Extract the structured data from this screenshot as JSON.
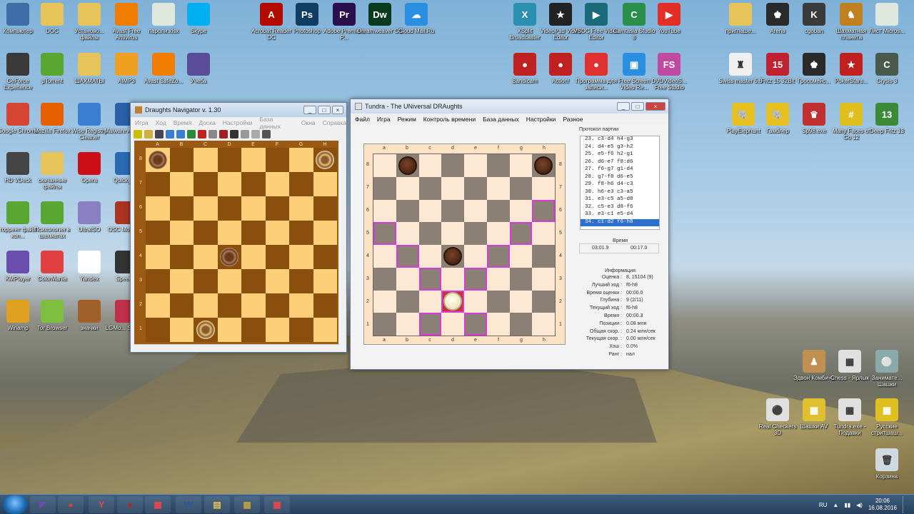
{
  "desktop": {
    "left_icons": [
      {
        "label": "Компьютер",
        "name": "computer-icon",
        "color": "#3d6ea8"
      },
      {
        "label": "DOC",
        "name": "folder-icon",
        "color": "#e6c45a"
      },
      {
        "label": "Установо... файлы",
        "name": "folder-icon",
        "color": "#e6c45a"
      },
      {
        "label": "Avast Free Antivirus",
        "name": "avast-icon",
        "color": "#f07d00"
      },
      {
        "label": "пароли.xlsx",
        "name": "excel-file-icon",
        "color": "#dfe8df"
      },
      {
        "label": "Skype",
        "name": "skype-icon",
        "color": "#00aff0"
      },
      {
        "label": "GeForce Experience",
        "name": "geforce-icon",
        "color": "#3a3a3a"
      },
      {
        "label": "µTorrent",
        "name": "utorrent-icon",
        "color": "#5aa632"
      },
      {
        "label": "ШАХМАТЫ",
        "name": "folder-icon",
        "color": "#e6c45a"
      },
      {
        "label": "AIMP3",
        "name": "aimp-icon",
        "color": "#f0a020"
      },
      {
        "label": "Avast SafeZo...",
        "name": "avast-safezone-icon",
        "color": "#f07d00"
      },
      {
        "label": "Учеба",
        "name": "folder-icon",
        "color": "#5b4c9a"
      },
      {
        "label": "Google Chrome",
        "name": "chrome-icon",
        "color": "#d64534"
      },
      {
        "label": "Mozilla Firefox",
        "name": "firefox-icon",
        "color": "#e66000"
      },
      {
        "label": "Wise Registry Cleaner",
        "name": "wise-icon",
        "color": "#3a7fcf"
      },
      {
        "label": "Malware Anti-M...",
        "name": "malware-icon",
        "color": "#2b5fa8"
      },
      {
        "label": "HD VDeck",
        "name": "hdvdeck-icon",
        "color": "#444"
      },
      {
        "label": "скачанные файлы",
        "name": "folder-icon",
        "color": "#e6c45a"
      },
      {
        "label": "Opera",
        "name": "opera-icon",
        "color": "#cc0f16"
      },
      {
        "label": "Quick_A...",
        "name": "quick-icon",
        "color": "#2a6ab0"
      },
      {
        "label": "торрент файл кол...",
        "name": "torrent-file-icon",
        "color": "#5aa632"
      },
      {
        "label": "Психология в шахматах",
        "name": "file-icon",
        "color": "#5aa632"
      },
      {
        "label": "UltraISO",
        "name": "ultraiso-icon",
        "color": "#8a7fc0"
      },
      {
        "label": "OSC Mouse ...",
        "name": "osc-icon",
        "color": "#aa3322"
      },
      {
        "label": "KMPlayer",
        "name": "kmplayer-icon",
        "color": "#6a4fb0"
      },
      {
        "label": "ColorMania",
        "name": "colormania-icon",
        "color": "#e04040"
      },
      {
        "label": "Yandex",
        "name": "yandex-icon",
        "color": "#ffffff"
      },
      {
        "label": "Speed...",
        "name": "speed-icon",
        "color": "#333"
      },
      {
        "label": "Winamp",
        "name": "winamp-icon",
        "color": "#e0a020"
      },
      {
        "label": "Tor Browser",
        "name": "tor-icon",
        "color": "#7fbf3f"
      },
      {
        "label": "значки",
        "name": "briefcase-icon",
        "color": "#a0602a"
      },
      {
        "label": "LGMo... Support",
        "name": "lg-icon",
        "color": "#c0304a"
      }
    ],
    "top_icons": [
      {
        "label": "Acrobat Reader DC",
        "name": "acrobat-icon",
        "color": "#b30b00",
        "glyph": "A"
      },
      {
        "label": "Photoshop",
        "name": "photoshop-icon",
        "color": "#0f3d63",
        "glyph": "Ps"
      },
      {
        "label": "Adobe Premiere P...",
        "name": "premiere-icon",
        "color": "#2a0f4f",
        "glyph": "Pr"
      },
      {
        "label": "Dreamweaver CC",
        "name": "dreamweaver-icon",
        "color": "#0a3a1e",
        "glyph": "Dw"
      },
      {
        "label": "Cloud Mail.Ru",
        "name": "cloud-icon",
        "color": "#2a8fe0",
        "glyph": "☁"
      },
      {
        "label": "XSplit Broadcaster",
        "name": "xsplit-icon",
        "color": "#2a8fb0",
        "glyph": "X"
      },
      {
        "label": "VideoPad Video Editor",
        "name": "videopad-icon",
        "color": "#222",
        "glyph": "★"
      },
      {
        "label": "VSDC Free Video Editor",
        "name": "vsdc-icon",
        "color": "#1a6a7a",
        "glyph": "▶"
      },
      {
        "label": "Camtasia Studio 8",
        "name": "camtasia-icon",
        "color": "#2a8f4a",
        "glyph": "C"
      },
      {
        "label": "YouTube",
        "name": "youtube-icon",
        "color": "#e52d27",
        "glyph": "▶"
      },
      {
        "label": "Bandicam",
        "name": "bandicam-icon",
        "color": "#c02020",
        "glyph": "●"
      },
      {
        "label": "Action!",
        "name": "action-icon",
        "color": "#c02020",
        "glyph": "●"
      },
      {
        "label": "Программа для записи...",
        "name": "recorder-icon",
        "color": "#e03030",
        "glyph": "●"
      },
      {
        "label": "Free Screen Video Re...",
        "name": "screen-recorder-icon",
        "color": "#2a8fe0",
        "glyph": "▣"
      },
      {
        "label": "DVDVideoS... Free Studio",
        "name": "freestudio-icon",
        "color": "#c04aa0",
        "glyph": "FS"
      }
    ],
    "right_icons": [
      {
        "label": "приглаше...",
        "name": "folder-icon",
        "color": "#e6c45a",
        "glyph": ""
      },
      {
        "label": "Arena",
        "name": "arena-icon",
        "color": "#2a2a2a",
        "glyph": "♚"
      },
      {
        "label": "cgoban",
        "name": "cgoban-icon",
        "color": "#3a3a3a",
        "glyph": "K"
      },
      {
        "label": "Шахматная планета",
        "name": "chess-planet-icon",
        "color": "#c08020",
        "glyph": "♞"
      },
      {
        "label": "Лист Micros...",
        "name": "excel-sheet-icon",
        "color": "#dfe8df",
        "glyph": ""
      },
      {
        "label": "Swiss master 5.5",
        "name": "swiss-master-icon",
        "color": "#f0f0f0",
        "glyph": "♜"
      },
      {
        "label": "Fritz 15 32Bit",
        "name": "fritz-icon",
        "color": "#c02030",
        "glyph": "15"
      },
      {
        "label": "Гроссмейс...",
        "name": "grossmeister-icon",
        "color": "#2a2a2a",
        "glyph": "♚"
      },
      {
        "label": "PokerStars...",
        "name": "pokerstars-icon",
        "color": "#c02020",
        "glyph": "★"
      },
      {
        "label": "Crysis 3",
        "name": "crysis-icon",
        "color": "#4a5a4a",
        "glyph": "C"
      },
      {
        "label": "PlayElephant",
        "name": "playelephant-icon",
        "color": "#e6c020",
        "glyph": "🐘"
      },
      {
        "label": "Гамблер",
        "name": "gambler-icon",
        "color": "#e6c020",
        "glyph": "🐘"
      },
      {
        "label": "Sp98.exe",
        "name": "sp98-icon",
        "color": "#c03030",
        "glyph": "♛"
      },
      {
        "label": "Many Faces of Go 12",
        "name": "manyfaces-icon",
        "color": "#e0c020",
        "glyph": "#"
      },
      {
        "label": "Deep Fritz 13",
        "name": "deepfritz-icon",
        "color": "#3a8a3a",
        "glyph": "13"
      },
      {
        "label": "Эдвон Комби+2",
        "name": "edvon-icon",
        "color": "#c09050",
        "glyph": "♟"
      },
      {
        "label": "Chess - Ярлык",
        "name": "chess-shortcut-icon",
        "color": "#e0e0e0",
        "glyph": "▦"
      },
      {
        "label": "Занимате... Шашки",
        "name": "zanimat-icon",
        "color": "#8aa",
        "glyph": "⚪"
      },
      {
        "label": "Real Checkers 3D",
        "name": "realcheckers-icon",
        "color": "#e0e0e0",
        "glyph": "⚫"
      },
      {
        "label": "Шашки AV",
        "name": "shashki-av-icon",
        "color": "#e0c030",
        "glyph": "▦"
      },
      {
        "label": "Tundra.exe - Подавки",
        "name": "tundra-shortcut-icon",
        "color": "#e0e0e0",
        "glyph": "▦"
      },
      {
        "label": "Русские стритшаш...",
        "name": "russian-checkers-icon",
        "color": "#e0c020",
        "glyph": "▦"
      },
      {
        "label": "Корзина",
        "name": "recycle-bin-icon",
        "color": "#d0d8e0",
        "glyph": "🗑"
      }
    ]
  },
  "navigator": {
    "title": "Draughts Navigator v. 1.30",
    "menu": [
      "Игра",
      "Ход",
      "Время",
      "Доска",
      "Настройки",
      "База данных",
      "Окна",
      "Справка"
    ],
    "files": [
      "A",
      "B",
      "C",
      "D",
      "E",
      "F",
      "G",
      "H"
    ],
    "ranks": [
      "8",
      "7",
      "6",
      "5",
      "4",
      "3",
      "2",
      "1"
    ],
    "pieces": [
      {
        "file": 1,
        "rank": 8,
        "color": "dark"
      },
      {
        "file": 8,
        "rank": 8,
        "color": "light"
      },
      {
        "file": 4,
        "rank": 4,
        "color": "dark"
      },
      {
        "file": 3,
        "rank": 1,
        "color": "light"
      }
    ]
  },
  "tundra": {
    "title": "Tundra - The UNiversal DRAughts",
    "menu": [
      "Файл",
      "Игра",
      "Режим",
      "Контроль времени",
      "База данных",
      "Настройки",
      "Разное"
    ],
    "files": [
      "a",
      "b",
      "c",
      "d",
      "e",
      "f",
      "g",
      "h"
    ],
    "ranks": [
      "8",
      "7",
      "6",
      "5",
      "4",
      "3",
      "2",
      "1"
    ],
    "pieces": [
      {
        "file": 2,
        "rank": 8,
        "color": "dark"
      },
      {
        "file": 8,
        "rank": 8,
        "color": "dark"
      },
      {
        "file": 4,
        "rank": 4,
        "color": "dark"
      },
      {
        "file": 4,
        "rank": 2,
        "color": "light"
      }
    ],
    "highlighted": [
      [
        8,
        6
      ],
      [
        7,
        5
      ],
      [
        6,
        4
      ],
      [
        5,
        3
      ],
      [
        5,
        1
      ],
      [
        4,
        2
      ],
      [
        3,
        3
      ],
      [
        2,
        4
      ],
      [
        1,
        5
      ],
      [
        3,
        1
      ]
    ],
    "selected_square": [
      4,
      2
    ],
    "protocol_label": "Протокол партии",
    "moves": [
      "23. c3-d4 h4-g3",
      "24. d4-e5 g3-h2",
      "25. e5-f6 h2-g1",
      "26. d6-e7 f8:d6",
      "27. f6-g7 g1-d4",
      "28. g7-f8 d6-e5",
      "29. f8-h6 d4-c3",
      "30. h6-e3 c3-a5",
      "31. e3-c5 a5-d8",
      "32. c5-e3 d8-f6",
      "33. e3-c1 e5-d4",
      "34. c1-d2 f6-h8"
    ],
    "selected_move_index": 11,
    "time_label": "Время",
    "time_white": "03:01.9",
    "time_black": "00:17.0",
    "info_title": "Информация",
    "info": [
      {
        "k": "Оценка :",
        "v": "8, 15104 (9)"
      },
      {
        "k": "Лучший ход :",
        "v": "f6-h8"
      },
      {
        "k": "Время оценки :",
        "v": "00:00.0"
      },
      {
        "k": "Глубина :",
        "v": "9 (2/11)"
      },
      {
        "k": "Текущий ход :",
        "v": "f6-h8"
      },
      {
        "k": "Время :",
        "v": "00:00.3"
      },
      {
        "k": "Позиции :",
        "v": "0.08 млн"
      },
      {
        "k": "Общая скор. :",
        "v": "0.24 млн/сек"
      },
      {
        "k": "Текущая скор. :",
        "v": "0.00 млн/сек"
      },
      {
        "k": "Хэш :",
        "v": "0.0%"
      },
      {
        "k": "Ранг :",
        "v": "нал"
      }
    ]
  },
  "taskbar": {
    "items": [
      {
        "name": "kmplayer-taskbar-icon",
        "color": "#6a4fb0",
        "glyph": "◤"
      },
      {
        "name": "chrome-taskbar-icon",
        "color": "#d64534",
        "glyph": "●"
      },
      {
        "name": "yandex-taskbar-icon",
        "color": "#ffffff",
        "glyph": "Y"
      },
      {
        "name": "recorder-taskbar-icon",
        "color": "#c02020",
        "glyph": "●"
      },
      {
        "name": "checkers-taskbar-icon",
        "color": "#e0e0e0",
        "glyph": "▦"
      },
      {
        "name": "word-taskbar-icon",
        "color": "#2b5797",
        "glyph": "W"
      },
      {
        "name": "explorer-taskbar-icon",
        "color": "#e6c45a",
        "glyph": "▤"
      },
      {
        "name": "navigator-taskbar-icon",
        "color": "#c0a040",
        "glyph": "▦"
      },
      {
        "name": "tundra-taskbar-icon",
        "color": "#e0e0e0",
        "glyph": "▦"
      }
    ],
    "lang": "RU",
    "time": "20:06",
    "date": "16.08.2016"
  }
}
